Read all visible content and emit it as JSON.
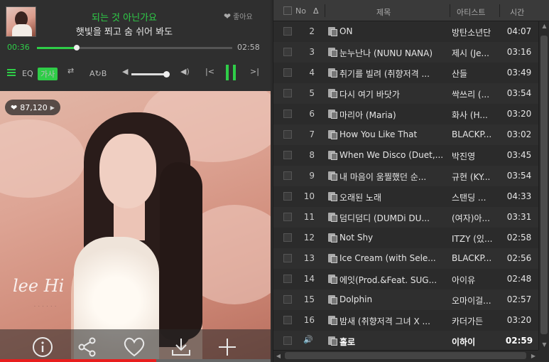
{
  "now_playing": {
    "title": "되는 것 아닌가요",
    "lyric": "햇빛을 쬐고 숨 쉬어 봐도",
    "like_label": "좋아요",
    "elapsed": "00:36",
    "total": "02:58",
    "progress": 0.203
  },
  "controls": {
    "eq_label": "EQ",
    "lyrics_label": "가사",
    "ab_label": "A↻B",
    "volume": 0.9
  },
  "album": {
    "like_count": "87,120",
    "logo_text": "lee Hi"
  },
  "playlist": {
    "headers": {
      "no": "No",
      "title": "제목",
      "artist": "아티스트",
      "time": "시간"
    },
    "rows": [
      {
        "no": "2",
        "title": "ON",
        "artist": "방탄소년단",
        "time": "04:07",
        "current": false
      },
      {
        "no": "3",
        "title": "눈누난나 (NUNU NANA)",
        "artist": "제시 (Je...",
        "time": "03:16",
        "current": false
      },
      {
        "no": "4",
        "title": "취기를 빌려 (취향저격 ...",
        "artist": "산들",
        "time": "03:49",
        "current": false
      },
      {
        "no": "5",
        "title": "다시 여기 바닷가",
        "artist": "싹쓰리 (...",
        "time": "03:54",
        "current": false
      },
      {
        "no": "6",
        "title": "마리아 (Maria)",
        "artist": "화사 (H...",
        "time": "03:20",
        "current": false
      },
      {
        "no": "7",
        "title": "How You Like That",
        "artist": "BLACKP...",
        "time": "03:02",
        "current": false
      },
      {
        "no": "8",
        "title": "When We Disco (Duet,...",
        "artist": "박진영",
        "time": "03:45",
        "current": false
      },
      {
        "no": "9",
        "title": "내 마음이 움찔했던 순...",
        "artist": "규현 (KY...",
        "time": "03:54",
        "current": false
      },
      {
        "no": "10",
        "title": "오래된 노래",
        "artist": "스탠딩 ...",
        "time": "04:33",
        "current": false
      },
      {
        "no": "11",
        "title": "덤디덤디 (DUMDi DU...",
        "artist": "(여자)아...",
        "time": "03:31",
        "current": false
      },
      {
        "no": "12",
        "title": "Not Shy",
        "artist": "ITZY (있...",
        "time": "02:58",
        "current": false
      },
      {
        "no": "13",
        "title": "Ice Cream (with Sele...",
        "artist": "BLACKP...",
        "time": "02:56",
        "current": false
      },
      {
        "no": "14",
        "title": "에잇(Prod.&Feat. SUG...",
        "artist": "아이유",
        "time": "02:48",
        "current": false
      },
      {
        "no": "15",
        "title": "Dolphin",
        "artist": "오마이걸...",
        "time": "02:57",
        "current": false
      },
      {
        "no": "16",
        "title": "밤새 (취향저격 그녀 X ...",
        "artist": "카더가든",
        "time": "03:20",
        "current": false
      },
      {
        "no": "",
        "title": "홀로",
        "artist": "이하이",
        "time": "02:59",
        "current": true
      }
    ]
  },
  "colors": {
    "accent": "#2fcd48",
    "bg": "#2b2b2b",
    "progress_red": "#e81e1e"
  }
}
